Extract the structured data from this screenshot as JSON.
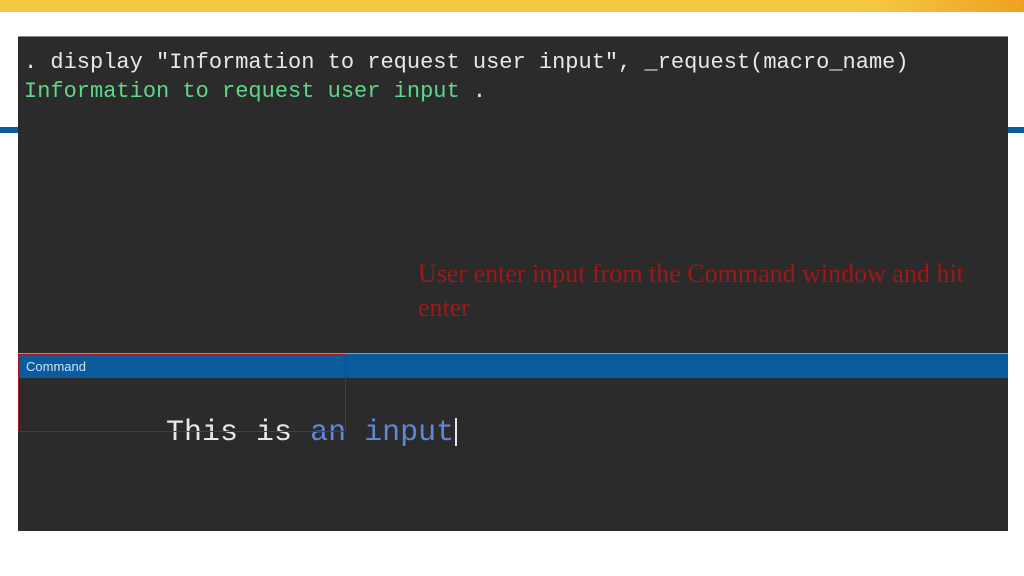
{
  "console": {
    "command_line": ". display \"Information to request user input\", _request(macro_name)",
    "output_text": "Information to request user input",
    "output_trailing": " ."
  },
  "annotation": {
    "text": "User enter input from the Command window and hit enter"
  },
  "command_panel": {
    "title": "Command",
    "input_value": "This is an input",
    "input_part1": "This is ",
    "input_part2": "an input"
  },
  "colors": {
    "background": "#2b2b2b",
    "header_blue": "#0a5a9c",
    "output_green": "#5fd787",
    "keyword_blue": "#5f87d7",
    "annotation_red": "#a01818",
    "top_yellow": "#f5c842"
  }
}
